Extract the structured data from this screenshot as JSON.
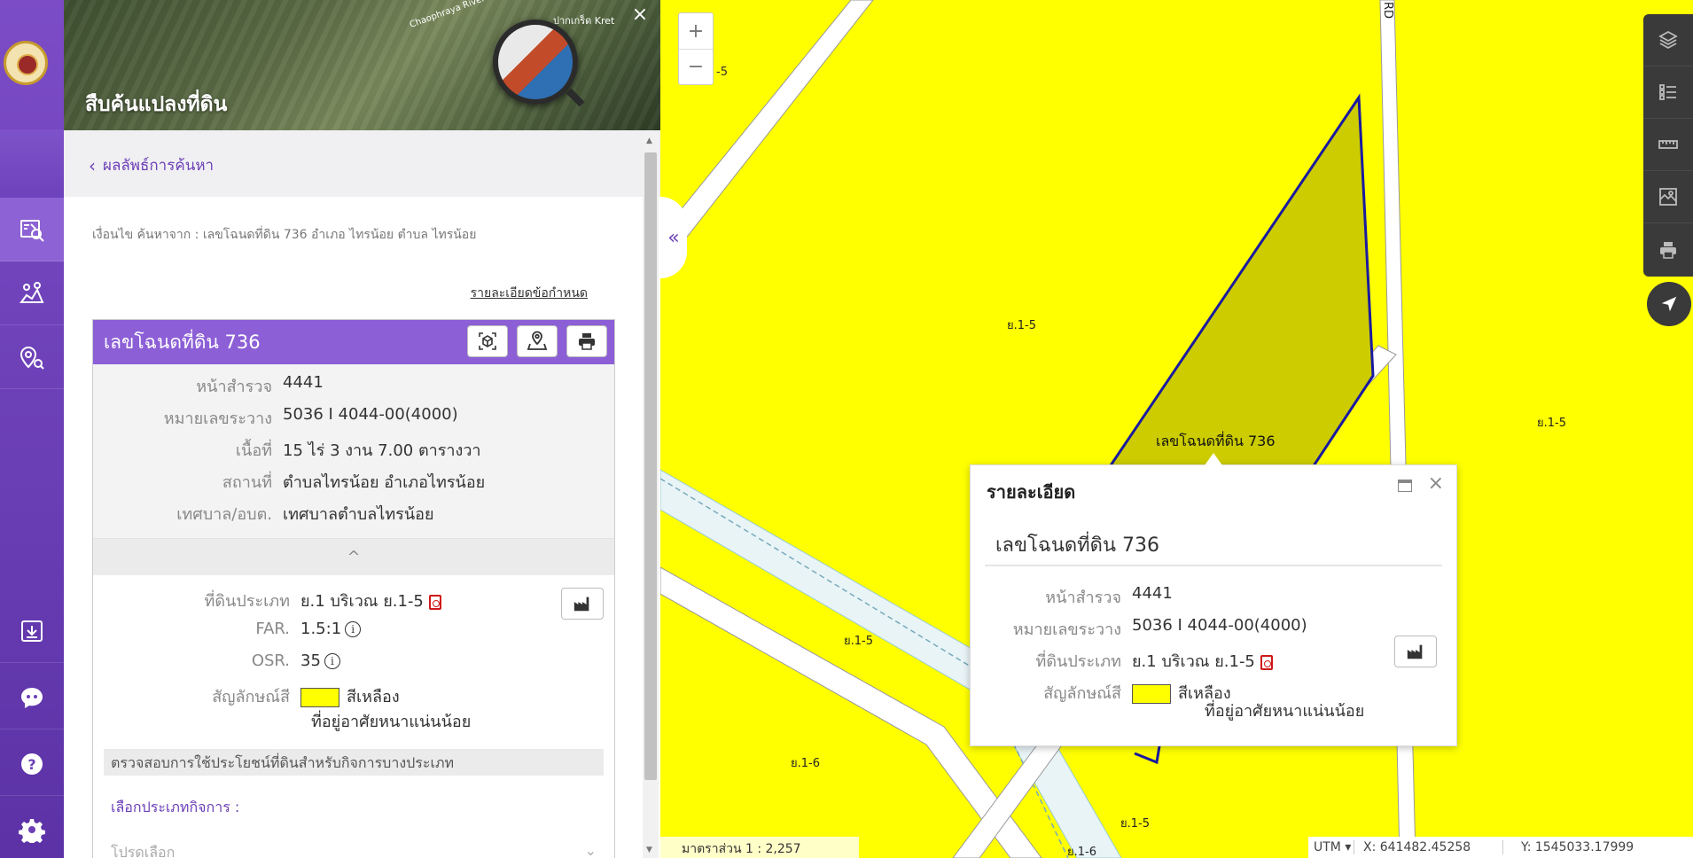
{
  "panel": {
    "title": "สืบค้นแปลงที่ดิน",
    "close": "×",
    "banner_labels": [
      "Chaophraya River",
      "ปากเกร็ด Kret"
    ],
    "back_label": "ผลลัพธ์การค้นหา",
    "condition": "เงื่อนไข ค้นหาจาก : เลขโฉนดที่ดิน 736 อำเภอ ไทรน้อย ตำบล ไทรน้อย",
    "detail_link": "รายละเอียดข้อกำหนด"
  },
  "card": {
    "title": "เลขโฉนดที่ดิน 736",
    "rows": [
      {
        "label": "หน้าสำรวจ",
        "value": "4441"
      },
      {
        "label": "หมายเลขระวาง",
        "value": "5036 I 4044-00(4000)"
      },
      {
        "label": "เนื้อที่",
        "value": "15 ไร่ 3 งาน 7.00 ตารางวา"
      },
      {
        "label": "สถานที่",
        "value": "ตำบลไทรน้อย อำเภอไทรน้อย"
      },
      {
        "label": "เทศบาล/อบต.",
        "value": "เทศบาลตำบลไทรน้อย"
      }
    ],
    "collapse_icon": "^",
    "zone": {
      "type_label": "ที่ดินประเภท",
      "type_value": "ย.1 บริเวณ ย.1-5",
      "far_label": "FAR.",
      "far_value": "1.5:1",
      "osr_label": "OSR.",
      "osr_value": "35",
      "color_label": "สัญลักษณ์สี",
      "color_value": "สีเหลือง",
      "color_desc": "ที่อยู่อาศัยหนาแน่นน้อย",
      "swatch_color": "#ffff00"
    },
    "check_title": "ตรวจสอบการใช้ประโยชน์ที่ดินสำหรับกิจการบางประเภท",
    "select_label": "เลือกประเภทกิจการ :",
    "select_placeholder": "โปรดเลือก",
    "select_chevron": "⌄"
  },
  "map": {
    "collapse_tab": "«",
    "zoom_in": "+",
    "zoom_out": "−",
    "zoom_note": "-5",
    "labels": [
      "ย.1-5",
      "ย.1-5",
      "ย.1-5",
      "ย.1-6",
      "ย.1-5",
      "ย.1-6",
      "RD"
    ],
    "parcel_label": "เลขโฉนดที่ดิน 736",
    "scale": "มาตราส่วน 1 : 2,257",
    "crs": "UTM ▾",
    "x": "X:  641482.45258",
    "y": "Y:  1545033.17999"
  },
  "popup": {
    "title": "รายละเอียด",
    "close": "×",
    "heading": "เลขโฉนดที่ดิน 736",
    "rows": [
      {
        "label": "หน้าสำรวจ",
        "value": "4441"
      },
      {
        "label": "หมายเลขระวาง",
        "value": "5036 I 4044-00(4000)"
      },
      {
        "label": "ที่ดินประเภท",
        "value": "ย.1 บริเวณ ย.1-5"
      },
      {
        "label": "สัญลักษณ์สี",
        "value": "สีเหลือง"
      }
    ],
    "desc": "ที่อยู่อาศัยหนาแน่นน้อย"
  },
  "colors": {
    "accent": "#8c5fd6",
    "rail": "#6c3fb6",
    "map_fill": "#ffff00",
    "parcel_fill": "#cccc00",
    "parcel_stroke": "#1a1aa0"
  }
}
